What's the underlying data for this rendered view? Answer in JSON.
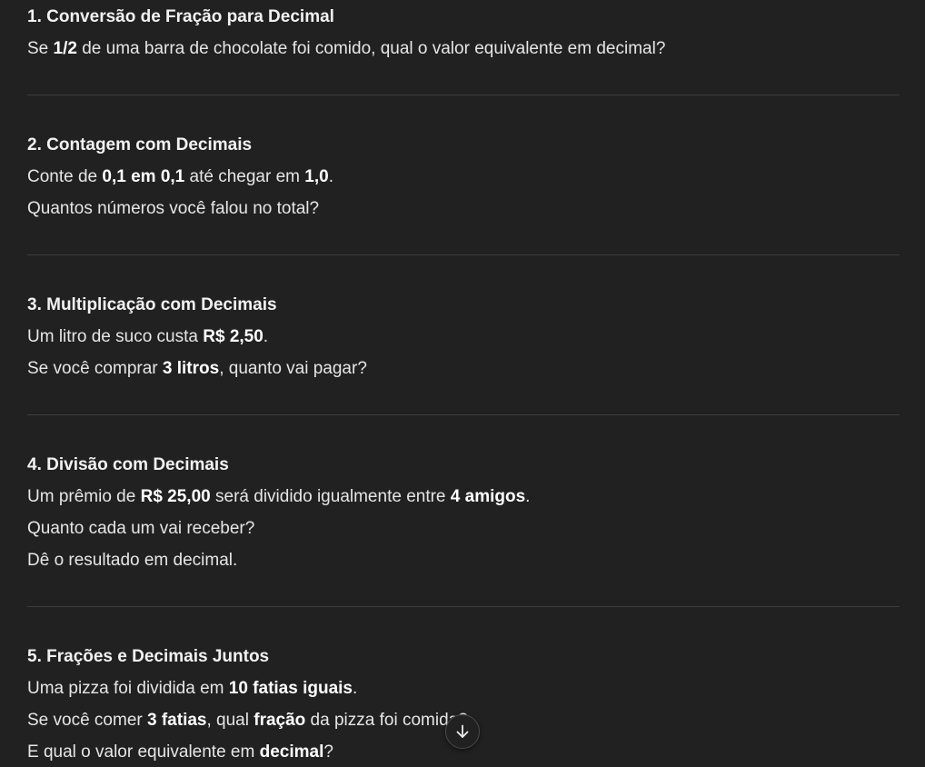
{
  "sections": [
    {
      "title": "1. Conversão de Fração para Decimal",
      "lines": [
        [
          {
            "t": "Se "
          },
          {
            "t": "1/2",
            "b": true
          },
          {
            "t": " de uma barra de chocolate foi comido, qual o valor equivalente em decimal?"
          }
        ]
      ]
    },
    {
      "title": "2. Contagem com Decimais",
      "lines": [
        [
          {
            "t": "Conte de "
          },
          {
            "t": "0,1 em 0,1",
            "b": true
          },
          {
            "t": " até chegar em "
          },
          {
            "t": "1,0",
            "b": true
          },
          {
            "t": "."
          }
        ],
        [
          {
            "t": "Quantos números você falou no total?"
          }
        ]
      ]
    },
    {
      "title": "3. Multiplicação com Decimais",
      "lines": [
        [
          {
            "t": "Um litro de suco custa "
          },
          {
            "t": "R$ 2,50",
            "b": true
          },
          {
            "t": "."
          }
        ],
        [
          {
            "t": "Se você comprar "
          },
          {
            "t": "3 litros",
            "b": true
          },
          {
            "t": ", quanto vai pagar?"
          }
        ]
      ]
    },
    {
      "title": "4. Divisão com Decimais",
      "lines": [
        [
          {
            "t": "Um prêmio de "
          },
          {
            "t": "R$ 25,00",
            "b": true
          },
          {
            "t": " será dividido igualmente entre "
          },
          {
            "t": "4 amigos",
            "b": true
          },
          {
            "t": "."
          }
        ],
        [
          {
            "t": "Quanto cada um vai receber?"
          }
        ],
        [
          {
            "t": "Dê o resultado em decimal."
          }
        ]
      ]
    },
    {
      "title": "5. Frações e Decimais Juntos",
      "lines": [
        [
          {
            "t": "Uma pizza foi dividida em "
          },
          {
            "t": "10 fatias iguais",
            "b": true
          },
          {
            "t": "."
          }
        ],
        [
          {
            "t": "Se você comer "
          },
          {
            "t": "3 fatias",
            "b": true
          },
          {
            "t": ", qual "
          },
          {
            "t": "fração",
            "b": true
          },
          {
            "t": " da pizza foi comida?"
          }
        ],
        [
          {
            "t": "E qual o valor equivalente em "
          },
          {
            "t": "decimal",
            "b": true
          },
          {
            "t": "?"
          }
        ]
      ]
    }
  ],
  "scroll_button": {
    "icon": "arrow-down-icon"
  }
}
